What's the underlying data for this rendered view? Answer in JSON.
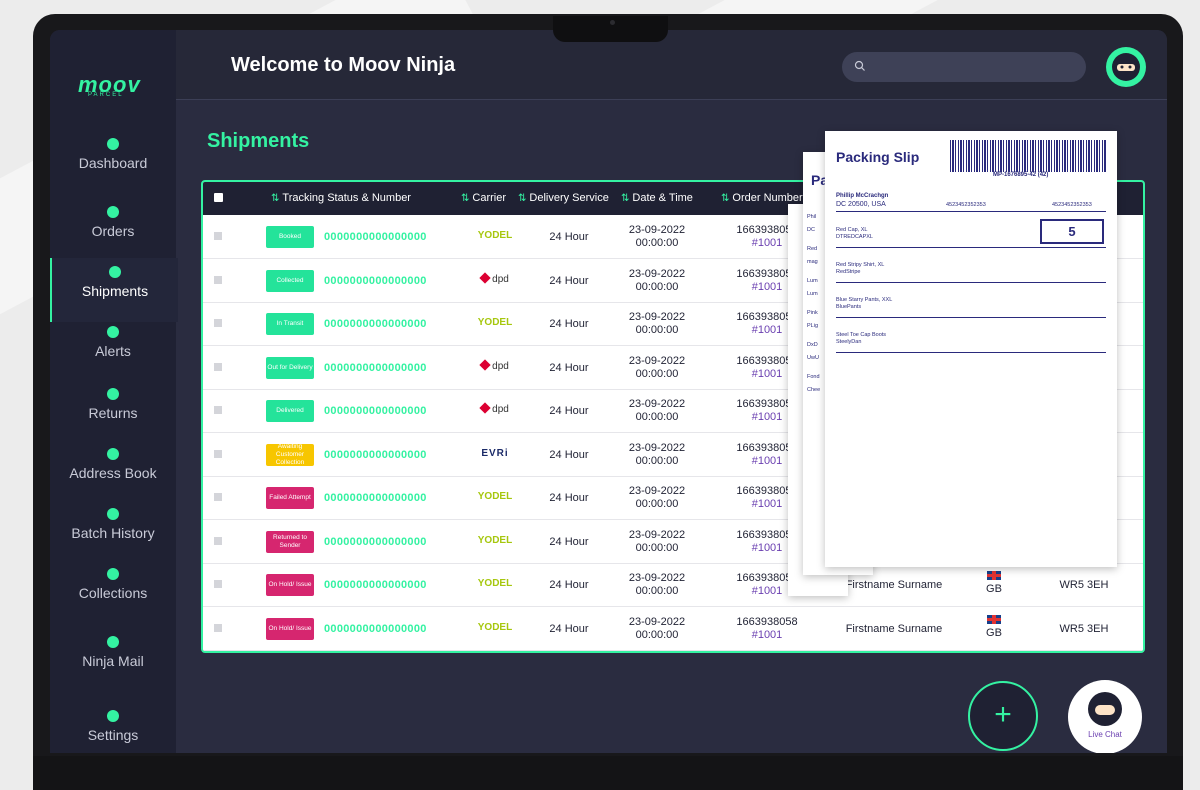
{
  "app": {
    "logo": "moov",
    "logo_sub": "PARCEL",
    "welcome": "Welcome to Moov Ninja",
    "page_title": "Shipments"
  },
  "colors": {
    "accent": "#34f2a2",
    "sidebar": "#1f2133",
    "booked": "#24e39a",
    "collected": "#24e39a",
    "awaiting": "#f7c600",
    "failed": "#d6266f"
  },
  "nav": [
    {
      "label": "Dashboard",
      "icon": "pie-chart-icon"
    },
    {
      "label": "Orders",
      "icon": "basket-icon"
    },
    {
      "label": "Shipments",
      "icon": "paper-plane-icon",
      "active": true
    },
    {
      "label": "Alerts",
      "icon": "alert-icon"
    },
    {
      "label": "Returns",
      "icon": "returns-icon"
    },
    {
      "label": "Address Book",
      "icon": "address-book-icon"
    },
    {
      "label": "Batch History",
      "icon": "stack-icon"
    },
    {
      "label": "Collections",
      "icon": "truck-icon"
    },
    {
      "label": "Ninja Mail",
      "icon": "mail-icon"
    },
    {
      "label": "Settings",
      "icon": "shuriken-icon"
    }
  ],
  "table": {
    "headers": {
      "tracking": "Tracking Status & Number",
      "carrier": "Carrier",
      "service": "Delivery Service",
      "datetime": "Date & Time",
      "order": "Order Number"
    },
    "rows": [
      {
        "status": "Booked",
        "status_color": "#24e39a",
        "tracking": "0000000000000000",
        "carrier": "YODEL",
        "service": "24 Hour",
        "date": "23-09-2022",
        "time": "00:00:00",
        "order": "1663938058",
        "ref": "#1001"
      },
      {
        "status": "Collected",
        "status_color": "#24e39a",
        "tracking": "0000000000000000",
        "carrier": "dpd",
        "service": "24 Hour",
        "date": "23-09-2022",
        "time": "00:00:00",
        "order": "1663938058",
        "ref": "#1001"
      },
      {
        "status": "In Transit",
        "status_color": "#24e39a",
        "tracking": "0000000000000000",
        "carrier": "YODEL",
        "service": "24 Hour",
        "date": "23-09-2022",
        "time": "00:00:00",
        "order": "1663938058",
        "ref": "#1001"
      },
      {
        "status": "Out for Delivery",
        "status_color": "#24e39a",
        "tracking": "0000000000000000",
        "carrier": "dpd",
        "service": "24 Hour",
        "date": "23-09-2022",
        "time": "00:00:00",
        "order": "1663938058",
        "ref": "#1001"
      },
      {
        "status": "Delivered",
        "status_color": "#24e39a",
        "tracking": "0000000000000000",
        "carrier": "dpd",
        "service": "24 Hour",
        "date": "23-09-2022",
        "time": "00:00:00",
        "order": "1663938058",
        "ref": "#1001"
      },
      {
        "status": "Awaiting Customer Collection",
        "status_color": "#f7c600",
        "tracking": "0000000000000000",
        "carrier": "EVRi",
        "service": "24 Hour",
        "date": "23-09-2022",
        "time": "00:00:00",
        "order": "1663938058",
        "ref": "#1001"
      },
      {
        "status": "Failed Attempt",
        "status_color": "#d6266f",
        "tracking": "0000000000000000",
        "carrier": "YODEL",
        "service": "24 Hour",
        "date": "23-09-2022",
        "time": "00:00:00",
        "order": "1663938058",
        "ref": "#1001"
      },
      {
        "status": "Returned to Sender",
        "status_color": "#d6266f",
        "tracking": "0000000000000000",
        "carrier": "YODEL",
        "service": "24 Hour",
        "date": "23-09-2022",
        "time": "00:00:00",
        "order": "1663938058",
        "ref": "#1001"
      },
      {
        "status": "On Hold/ Issue",
        "status_color": "#d6266f",
        "tracking": "0000000000000000",
        "carrier": "YODEL",
        "service": "24 Hour",
        "date": "23-09-2022",
        "time": "00:00:00",
        "order": "1663938058",
        "ref": "#1001",
        "customer": "Firstname Surname",
        "country": "GB",
        "postcode": "WR5 3EH"
      },
      {
        "status": "On Hold/ Issue",
        "status_color": "#d6266f",
        "tracking": "0000000000000000",
        "carrier": "YODEL",
        "service": "24 Hour",
        "date": "23-09-2022",
        "time": "00:00:00",
        "order": "1663938058",
        "ref": "#1001",
        "customer": "Firstname Surname",
        "country": "GB",
        "postcode": "WR5 3EH"
      }
    ]
  },
  "packing_slip": {
    "title": "Packing Slip",
    "barcode": "MP-1676895-42 (42)",
    "name": "Phillip McCrachgn",
    "address": "DC 20500, USA",
    "ref1": "4523452352353",
    "ref2": "4523452352353",
    "qty": "5",
    "items": [
      {
        "name": "Red Cap, XL",
        "sku": "DTREDCAPXL"
      },
      {
        "name": "Red Stripy Shirt, XL",
        "sku": "RedStripe"
      },
      {
        "name": "Blue Starry Pants, XXL",
        "sku": "BluePants"
      },
      {
        "name": "Steel Toe Cap Boots",
        "sku": "SteelyDan"
      }
    ],
    "behind_title": "Pa",
    "behind_lines": [
      "Phil",
      "DC",
      "Red",
      "mag",
      "Lum",
      "Lum",
      "Pink",
      "PLig",
      "DxD",
      "UwU",
      "Fond",
      "Chee"
    ]
  },
  "chat": {
    "label": "Live Chat"
  },
  "fab": {
    "label": "+"
  }
}
